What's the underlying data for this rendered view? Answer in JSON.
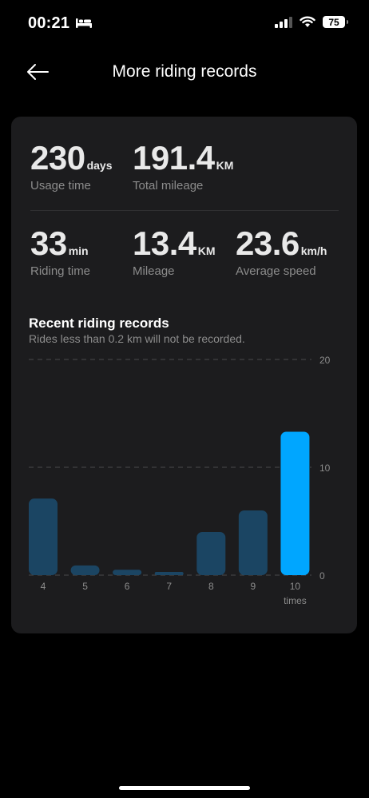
{
  "status_bar": {
    "time": "00:21",
    "battery": "75"
  },
  "header": {
    "title": "More riding records"
  },
  "stats": {
    "usage_time": {
      "value": "230",
      "unit": "days",
      "label": "Usage time"
    },
    "total_mileage": {
      "value": "191.4",
      "unit": "KM",
      "label": "Total mileage"
    },
    "riding_time": {
      "value": "33",
      "unit": "min",
      "label": "Riding time"
    },
    "mileage": {
      "value": "13.4",
      "unit": "KM",
      "label": "Mileage"
    },
    "average_speed": {
      "value": "23.6",
      "unit": "km/h",
      "label": "Average speed"
    }
  },
  "recent": {
    "title": "Recent riding records",
    "subtitle": "Rides less than 0.2 km will not be recorded."
  },
  "chart_data": {
    "type": "bar",
    "categories": [
      "4",
      "5",
      "6",
      "7",
      "8",
      "9",
      "10"
    ],
    "values": [
      7.1,
      0.9,
      0.5,
      0.3,
      4.0,
      6.0,
      13.3
    ],
    "highlight_index": 6,
    "x_unit_label": "times",
    "ylim": [
      0,
      20
    ],
    "yticks": [
      0,
      10,
      20
    ],
    "grid": true,
    "colors": {
      "bar": "#1b4563",
      "highlight": "#00a6ff",
      "grid": "#4a4a4c",
      "tick": "#8c8c8c"
    }
  },
  "colors": {
    "background": "#000000",
    "card": "#1c1c1e",
    "accent": "#00a6ff"
  }
}
